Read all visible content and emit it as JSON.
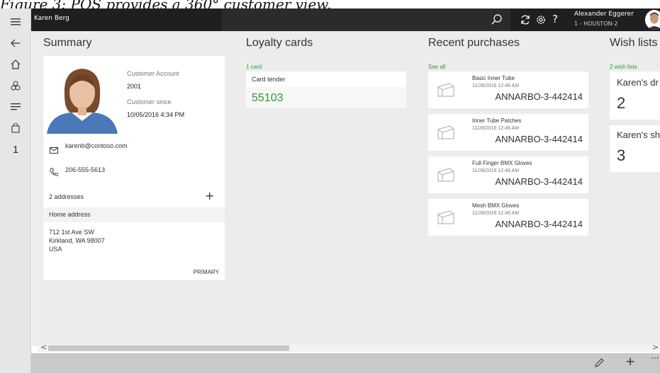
{
  "caption": "Figure 3: POS provides a 360° customer view.",
  "app": {
    "customer_title": "Karen Berg"
  },
  "user": {
    "name": "Alexander Eggerer",
    "store": "1 - HOUSTON-2"
  },
  "rail": {
    "cart_count": "1"
  },
  "summary": {
    "heading": "Summary",
    "account_label": "Customer Account",
    "account_number": "2001",
    "since_label": "Customer since",
    "since_value": "10/05/2016 4:34 PM",
    "email": "karenb@contoso.com",
    "phone": "206-555-5613",
    "addresses_link": "2 addresses",
    "address_type": "Home address",
    "address_lines": [
      "712 1st Ave SW",
      "Kirkland, WA 98007",
      "USA"
    ],
    "primary_tag": "PRIMARY"
  },
  "loyalty": {
    "heading": "Loyalty cards",
    "count_label": "1 card",
    "card_label": "Card tender",
    "card_number": "55103"
  },
  "recent": {
    "heading": "Recent purchases",
    "see_all": "See all",
    "items": [
      {
        "name": "Basic Inner Tube",
        "date": "11/28/2016 12:46 AM",
        "order": "ANNARBO-3-442414"
      },
      {
        "name": "Inner Tube Patches",
        "date": "11/28/2016 12:46 AM",
        "order": "ANNARBO-3-442414"
      },
      {
        "name": "Full Finger BMX Gloves",
        "date": "11/28/2016 12:46 AM",
        "order": "ANNARBO-3-442414"
      },
      {
        "name": "Mesh BMX Gloves",
        "date": "11/28/2016 12:46 AM",
        "order": "ANNARBO-3-442414"
      }
    ]
  },
  "wishlists": {
    "heading": "Wish lists",
    "count_label": "2 wish lists",
    "lists": [
      {
        "name": "Karen's dr",
        "count": "2"
      },
      {
        "name": "Karen's sh",
        "count": "3"
      }
    ]
  },
  "colors": {
    "accent_green": "#2e9b2e",
    "topbar": "#1f1f1f",
    "canvas": "#ececec"
  },
  "icons": [
    "hamburger-icon",
    "back-icon",
    "home-icon",
    "products-icon",
    "transactions-icon",
    "cart-icon",
    "search-icon",
    "refresh-icon",
    "settings-icon",
    "help-icon",
    "mail-icon",
    "phone-icon",
    "plus-icon",
    "package-icon",
    "edit-icon",
    "add-icon",
    "more-icon"
  ]
}
